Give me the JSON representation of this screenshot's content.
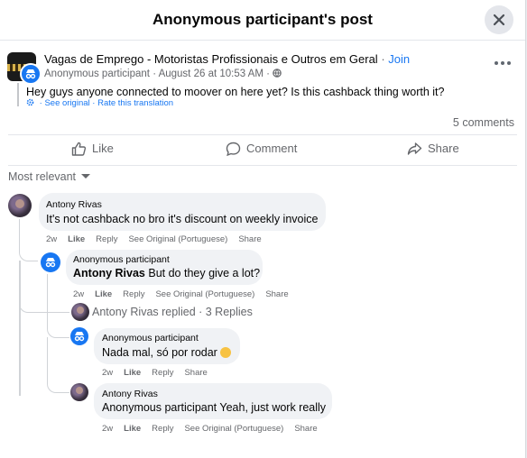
{
  "header": {
    "title": "Anonymous participant's post",
    "close_icon": "close-icon"
  },
  "post": {
    "group_name": "Vagas de Emprego - Motoristas Profissionais e Outros em Geral",
    "join_label": "Join",
    "author": "Anonymous participant",
    "date": "August 26 at 10:53 AM",
    "text": "Hey guys anyone connected to moover on here yet? Is this cashback thing worth it?",
    "see_original": "See original",
    "rate_translation": "Rate this translation",
    "comments_count": "5 comments"
  },
  "actions": {
    "like": "Like",
    "comment": "Comment",
    "share": "Share"
  },
  "sort_label": "Most relevant",
  "comments": [
    {
      "name": "Antony Rivas",
      "text": "It's not cashback no bro it's discount on weekly invoice",
      "time": "2w",
      "like": "Like",
      "reply": "Reply",
      "see_original": "See Original (Portuguese)",
      "share": "Share"
    },
    {
      "name": "Anonymous participant",
      "mention": "Antony Rivas",
      "text": "But do they give a lot?",
      "time": "2w",
      "like": "Like",
      "reply": "Reply",
      "see_original": "See Original (Portuguese)",
      "share": "Share"
    },
    {
      "name": "Anonymous participant",
      "text": "Nada mal, só por rodar",
      "time": "2w",
      "like": "Like",
      "reply": "Reply",
      "share": "Share"
    },
    {
      "name": "Antony Rivas",
      "mention": "Anonymous participant",
      "text": "Yeah, just work really",
      "time": "2w",
      "like": "Like",
      "reply": "Reply",
      "see_original": "See Original (Portuguese)",
      "share": "Share"
    }
  ],
  "replies_summary": "Antony Rivas replied · 3 Replies",
  "colors": {
    "accent": "#1877f2",
    "muted": "#65676b",
    "bubble": "#f0f2f5"
  }
}
